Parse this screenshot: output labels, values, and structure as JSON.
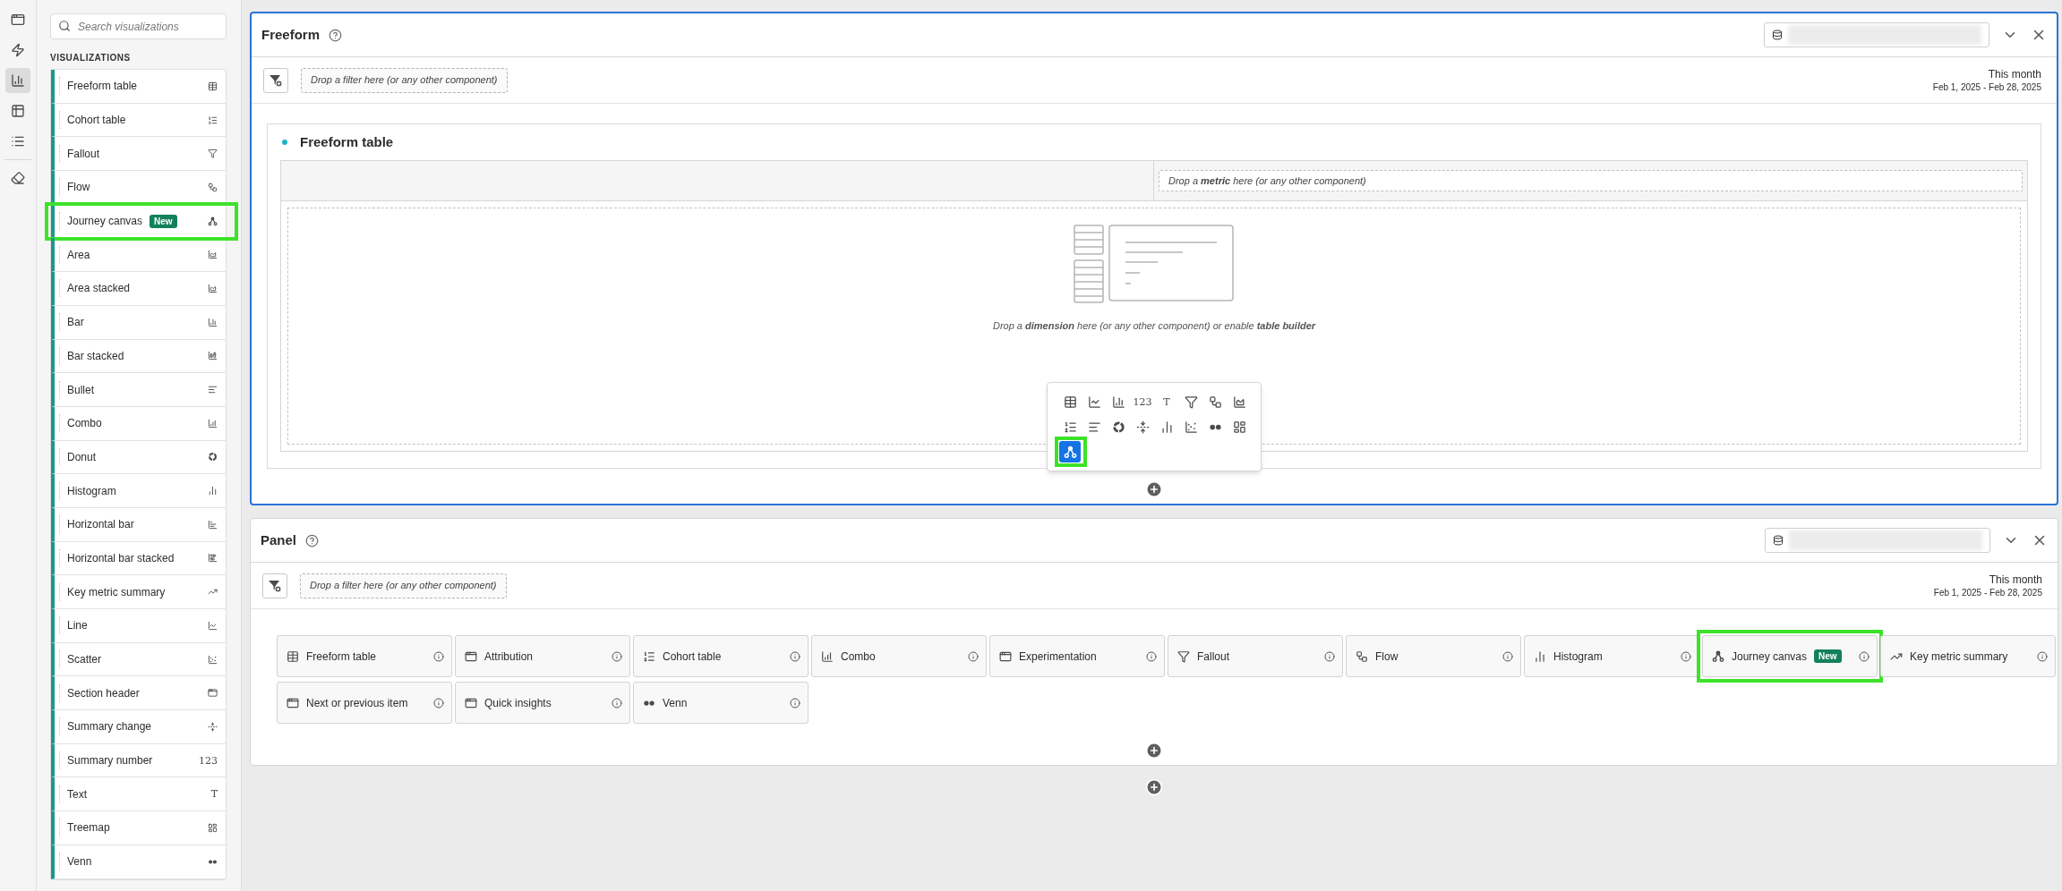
{
  "rail": [
    {
      "kind": "window",
      "selected": false
    },
    {
      "kind": "bolt",
      "selected": false
    },
    {
      "kind": "bars",
      "selected": true
    },
    {
      "kind": "grid",
      "selected": false
    },
    {
      "kind": "list",
      "selected": false
    },
    {
      "kind": "eraser",
      "selected": false
    }
  ],
  "sidebar": {
    "search": {
      "placeholder": "Search visualizations"
    },
    "heading": "VISUALIZATIONS",
    "items": [
      {
        "label": "Freeform table",
        "kind": "table",
        "highlighted": false
      },
      {
        "label": "Cohort table",
        "kind": "ordered",
        "highlighted": false
      },
      {
        "label": "Fallout",
        "kind": "funnel",
        "highlighted": false
      },
      {
        "label": "Flow",
        "kind": "flow",
        "highlighted": false
      },
      {
        "label": "Journey canvas",
        "kind": "journey",
        "badge": "New",
        "highlighted": true
      },
      {
        "label": "Area",
        "kind": "area",
        "highlighted": false
      },
      {
        "label": "Area stacked",
        "kind": "area-stacked",
        "highlighted": false
      },
      {
        "label": "Bar",
        "kind": "bar",
        "highlighted": false
      },
      {
        "label": "Bar stacked",
        "kind": "bar-stacked",
        "highlighted": false
      },
      {
        "label": "Bullet",
        "kind": "bullet",
        "highlighted": false
      },
      {
        "label": "Combo",
        "kind": "combo",
        "highlighted": false
      },
      {
        "label": "Donut",
        "kind": "donut",
        "highlighted": false
      },
      {
        "label": "Histogram",
        "kind": "histogram",
        "highlighted": false
      },
      {
        "label": "Horizontal bar",
        "kind": "hbar",
        "highlighted": false
      },
      {
        "label": "Horizontal bar stacked",
        "kind": "hbar-stacked",
        "highlighted": false
      },
      {
        "label": "Key metric summary",
        "kind": "trend",
        "highlighted": false
      },
      {
        "label": "Line",
        "kind": "line",
        "highlighted": false
      },
      {
        "label": "Scatter",
        "kind": "scatter",
        "highlighted": false
      },
      {
        "label": "Section header",
        "kind": "window",
        "highlighted": false
      },
      {
        "label": "Summary change",
        "kind": "change",
        "highlighted": false
      },
      {
        "label": "Summary number",
        "kind": "glyph",
        "glyph": "123",
        "highlighted": false
      },
      {
        "label": "Text",
        "kind": "glyph",
        "glyph": "T",
        "highlighted": false
      },
      {
        "label": "Treemap",
        "kind": "treemap",
        "highlighted": false
      },
      {
        "label": "Venn",
        "kind": "venn",
        "highlighted": false
      }
    ]
  },
  "panels": [
    {
      "title": "Freeform",
      "selected": true,
      "filter_placeholder": "Drop a filter here (or any other component)",
      "date_label": "This month",
      "date_range": "Feb 1, 2025 - Feb 28, 2025",
      "kind": "table",
      "table": {
        "title": "Freeform table",
        "metric_placeholder": "Drop a **metric** here (or any other component)",
        "dimension_placeholder": "Drop a **dimension** here (or any other component) or enable **table builder**"
      },
      "picker": [
        {
          "kind": "table",
          "selected": false
        },
        {
          "kind": "line",
          "selected": false
        },
        {
          "kind": "bar",
          "selected": false
        },
        {
          "kind": "glyph",
          "glyph": "123",
          "selected": false
        },
        {
          "kind": "glyph",
          "glyph": "T",
          "selected": false
        },
        {
          "kind": "funnel",
          "selected": false
        },
        {
          "kind": "flow",
          "selected": false
        },
        {
          "kind": "area-stacked",
          "selected": false
        },
        {
          "kind": "ordered",
          "selected": false
        },
        {
          "kind": "bullet",
          "selected": false
        },
        {
          "kind": "donut",
          "selected": false
        },
        {
          "kind": "change",
          "selected": false
        },
        {
          "kind": "histogram",
          "selected": false
        },
        {
          "kind": "scatter",
          "selected": false
        },
        {
          "kind": "venn",
          "selected": false
        },
        {
          "kind": "treemap",
          "selected": false
        },
        {
          "kind": "journey",
          "selected": true,
          "highlighted": true
        }
      ]
    },
    {
      "title": "Panel",
      "selected": false,
      "filter_placeholder": "Drop a filter here (or any other component)",
      "date_label": "This month",
      "date_range": "Feb 1, 2025 - Feb 28, 2025",
      "kind": "starter",
      "cards": [
        {
          "label": "Freeform table",
          "kind": "table",
          "highlighted": false
        },
        {
          "label": "Attribution",
          "kind": "window",
          "highlighted": false
        },
        {
          "label": "Cohort table",
          "kind": "ordered",
          "highlighted": false
        },
        {
          "label": "Combo",
          "kind": "combo",
          "highlighted": false
        },
        {
          "label": "Experimentation",
          "kind": "window",
          "highlighted": false
        },
        {
          "label": "Fallout",
          "kind": "funnel",
          "highlighted": false
        },
        {
          "label": "Flow",
          "kind": "flow",
          "highlighted": false
        },
        {
          "label": "Histogram",
          "kind": "histogram",
          "highlighted": false
        },
        {
          "label": "Journey canvas",
          "kind": "journey",
          "badge": "New",
          "highlighted": true
        },
        {
          "label": "Key metric summary",
          "kind": "trend",
          "highlighted": false
        },
        {
          "label": "Next or previous item",
          "kind": "window",
          "highlighted": false
        },
        {
          "label": "Quick insights",
          "kind": "window",
          "highlighted": false
        },
        {
          "label": "Venn",
          "kind": "venn",
          "highlighted": false
        }
      ]
    }
  ]
}
